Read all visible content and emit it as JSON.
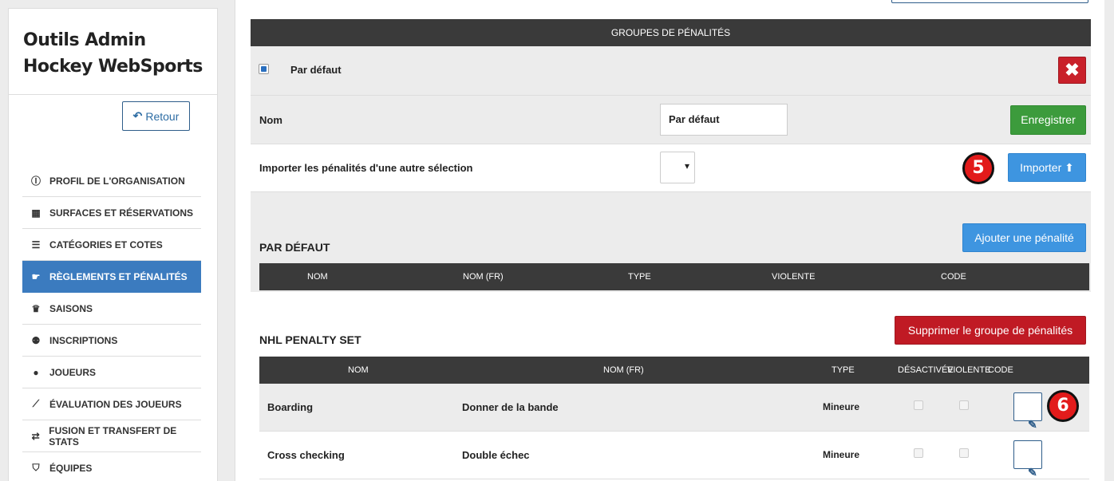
{
  "sidebar": {
    "title": "Outils Admin Hockey WebSports",
    "back_label": "Retour",
    "items": [
      {
        "label": "Profil de l'organisation",
        "icon": "ⓘ"
      },
      {
        "label": "Surfaces et réservations",
        "icon": "▦"
      },
      {
        "label": "Catégories et cotes",
        "icon": "☰"
      },
      {
        "label": "Règlements et pénalités",
        "icon": "☛"
      },
      {
        "label": "Saisons",
        "icon": "♛"
      },
      {
        "label": "Inscriptions",
        "icon": "⚉"
      },
      {
        "label": "Joueurs",
        "icon": "●"
      },
      {
        "label": "Évaluation des joueurs",
        "icon": "⟋"
      },
      {
        "label": "Fusion et transfert de stats",
        "icon": "⇄"
      },
      {
        "label": "Équipes",
        "icon": "⛉"
      }
    ],
    "active_index": 3
  },
  "groups": {
    "header": "Groupes de pénalités",
    "default_label": "Par défaut",
    "delete_symbol": "✖",
    "name_label": "Nom",
    "name_value": "Par défaut",
    "save_label": "Enregistrer",
    "import_label": "Importer les pénalités d'une autre sélection",
    "import_button": "Importer",
    "import_icon": "⬆",
    "badge_import": "5",
    "badge_edit": "6"
  },
  "section_default": {
    "title": "Par défaut",
    "add_button": "Ajouter une pénalité",
    "headers": [
      "Nom",
      "Nom (FR)",
      "Type",
      "Violente",
      "Code"
    ]
  },
  "section_nhl": {
    "title": "NHL penalty set",
    "delete_button": "Supprimer le groupe de pénalités",
    "headers": [
      "Nom",
      "Nom (FR)",
      "Type",
      "Désactivée",
      "Violente",
      "Code"
    ],
    "rows": [
      {
        "name": "Boarding",
        "name_fr": "Donner de la bande",
        "type": "Mineure"
      },
      {
        "name": "Cross checking",
        "name_fr": "Double échec",
        "type": "Mineure"
      }
    ]
  },
  "colors": {
    "active_nav": "#3b7bbf",
    "header_dark": "#3a3a3a",
    "save_green": "#3c9b3c",
    "primary_blue": "#3e95e0",
    "danger_red": "#c01a24",
    "badge_red": "#e21b1b"
  }
}
